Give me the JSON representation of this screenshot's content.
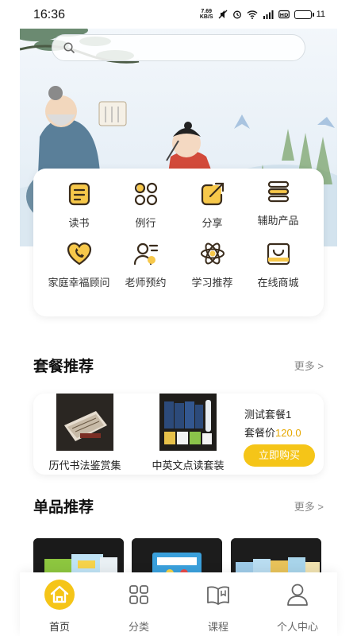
{
  "status_bar": {
    "time": "16:36",
    "net_speed_value": "7.69",
    "net_speed_unit": "KB/S",
    "battery_level": "11"
  },
  "search": {
    "placeholder": ""
  },
  "menu": {
    "items": [
      {
        "label": "读书",
        "icon": "book-icon"
      },
      {
        "label": "例行",
        "icon": "grid-flower-icon"
      },
      {
        "label": "分享",
        "icon": "share-icon"
      },
      {
        "label": "辅助产品",
        "icon": "stack-icon"
      },
      {
        "label": "家庭幸福顾问",
        "icon": "heart-phone-icon"
      },
      {
        "label": "老师预约",
        "icon": "teacher-icon"
      },
      {
        "label": "学习推荐",
        "icon": "atom-icon"
      },
      {
        "label": "在线商城",
        "icon": "shopping-bag-icon"
      }
    ]
  },
  "package_section": {
    "title": "套餐推荐",
    "more": "更多 >",
    "products": [
      {
        "name": "历代书法鉴赏集"
      },
      {
        "name": "中英文点读套装"
      }
    ],
    "package_name": "测试套餐1",
    "price_label": "套餐价",
    "price_value": "120.0",
    "buy_label": "立即购买"
  },
  "single_section": {
    "title": "单品推荐",
    "more": "更多 >"
  },
  "bottom_nav": {
    "items": [
      {
        "label": "首页",
        "icon": "home-icon",
        "active": true
      },
      {
        "label": "分类",
        "icon": "category-grid-icon",
        "active": false
      },
      {
        "label": "课程",
        "icon": "open-book-icon",
        "active": false
      },
      {
        "label": "个人中心",
        "icon": "user-icon",
        "active": false
      }
    ]
  },
  "colors": {
    "accent": "#f5c518",
    "price": "#e6a800",
    "icon_line": "#3a2c1c",
    "icon_fill": "#f7c84a"
  }
}
